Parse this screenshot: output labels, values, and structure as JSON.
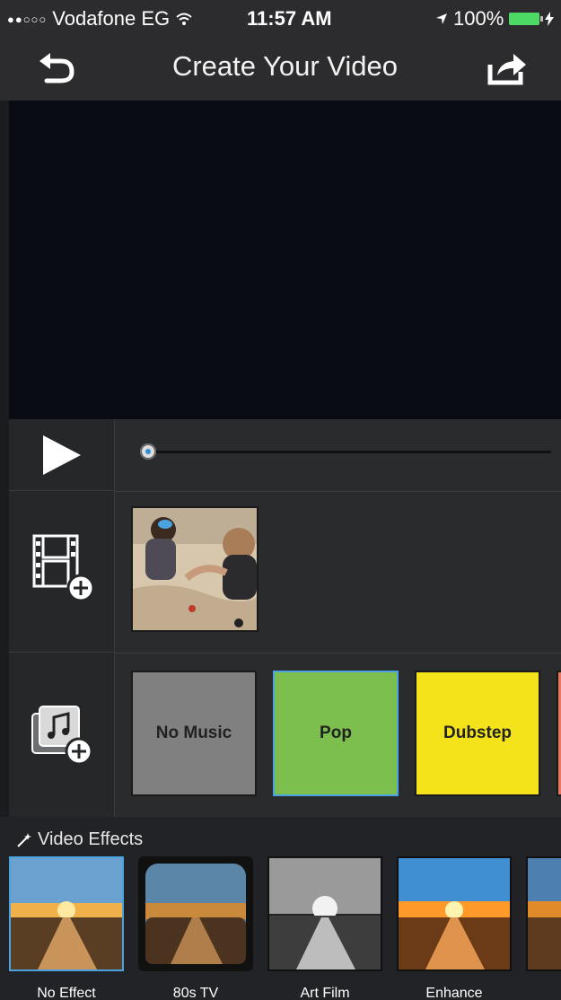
{
  "status_bar": {
    "signal": "●●○○○",
    "carrier": "Vodafone EG",
    "time": "11:57 AM",
    "battery": "100%"
  },
  "nav": {
    "title": "Create Your Video"
  },
  "icons": {
    "back": "undo-arrow-icon",
    "share": "share-icon",
    "play": "play-icon",
    "add_video": "add-video-icon",
    "add_music": "add-music-icon",
    "effects": "magic-wand-icon"
  },
  "music": {
    "tiles": [
      {
        "label": "No Music",
        "color": "#808080"
      },
      {
        "label": "Pop",
        "color": "#7dbf4f"
      },
      {
        "label": "Dubstep",
        "color": "#f4e21a"
      }
    ],
    "selected_index": 1
  },
  "effects": {
    "title": "Video Effects",
    "items": [
      {
        "label": "No Effect"
      },
      {
        "label": "80s TV"
      },
      {
        "label": "Art Film"
      },
      {
        "label": "Enhance"
      }
    ],
    "selected_index": 0
  },
  "colors": {
    "accent": "#4aa3e0",
    "background": "#1b1c1f",
    "preview": "#0a0c13"
  }
}
